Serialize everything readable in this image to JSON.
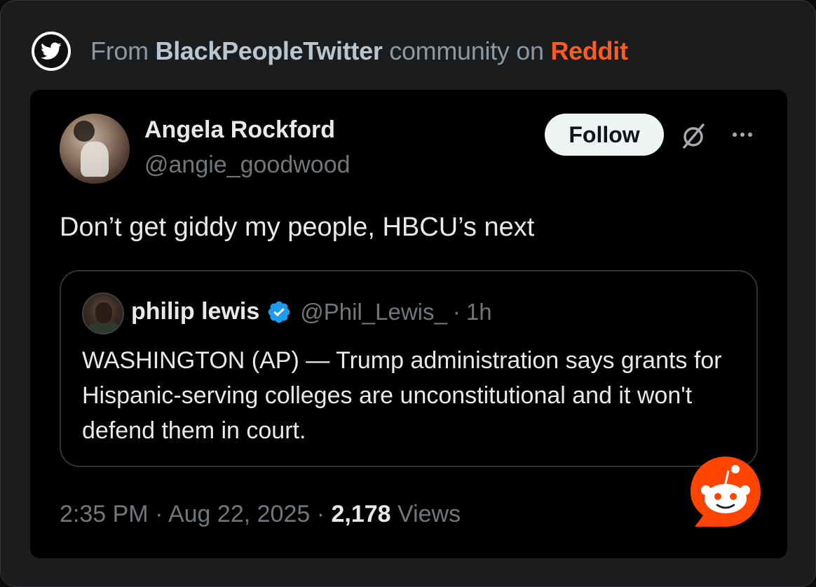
{
  "header": {
    "prefix": "From ",
    "community": "BlackPeopleTwitter",
    "middle": " community on ",
    "platform": "Reddit",
    "icon": "twitter-bird-icon"
  },
  "tweet": {
    "author_name": "Angela Rockford",
    "author_handle": "@angie_goodwood",
    "follow_label": "Follow",
    "text": "Don’t get giddy my people, HBCU’s next",
    "quote": {
      "author_name": "philip lewis",
      "author_handle": "@Phil_Lewis_",
      "separator": "·",
      "time": "1h",
      "text": "WASHINGTON (AP) — Trump administration says grants for Hispanic-serving colleges are unconstitutional and it won't defend them in court."
    },
    "meta": {
      "time": "2:35 PM",
      "sep1": " · ",
      "date": "Aug 22, 2025",
      "sep2": " · ",
      "views_count": "2,178",
      "views_label": " Views"
    }
  },
  "colors": {
    "reddit_orange": "#ff4500",
    "verified_blue": "#1d9bf0",
    "card_bg": "#1b1c1e",
    "tweet_bg": "#000000"
  }
}
